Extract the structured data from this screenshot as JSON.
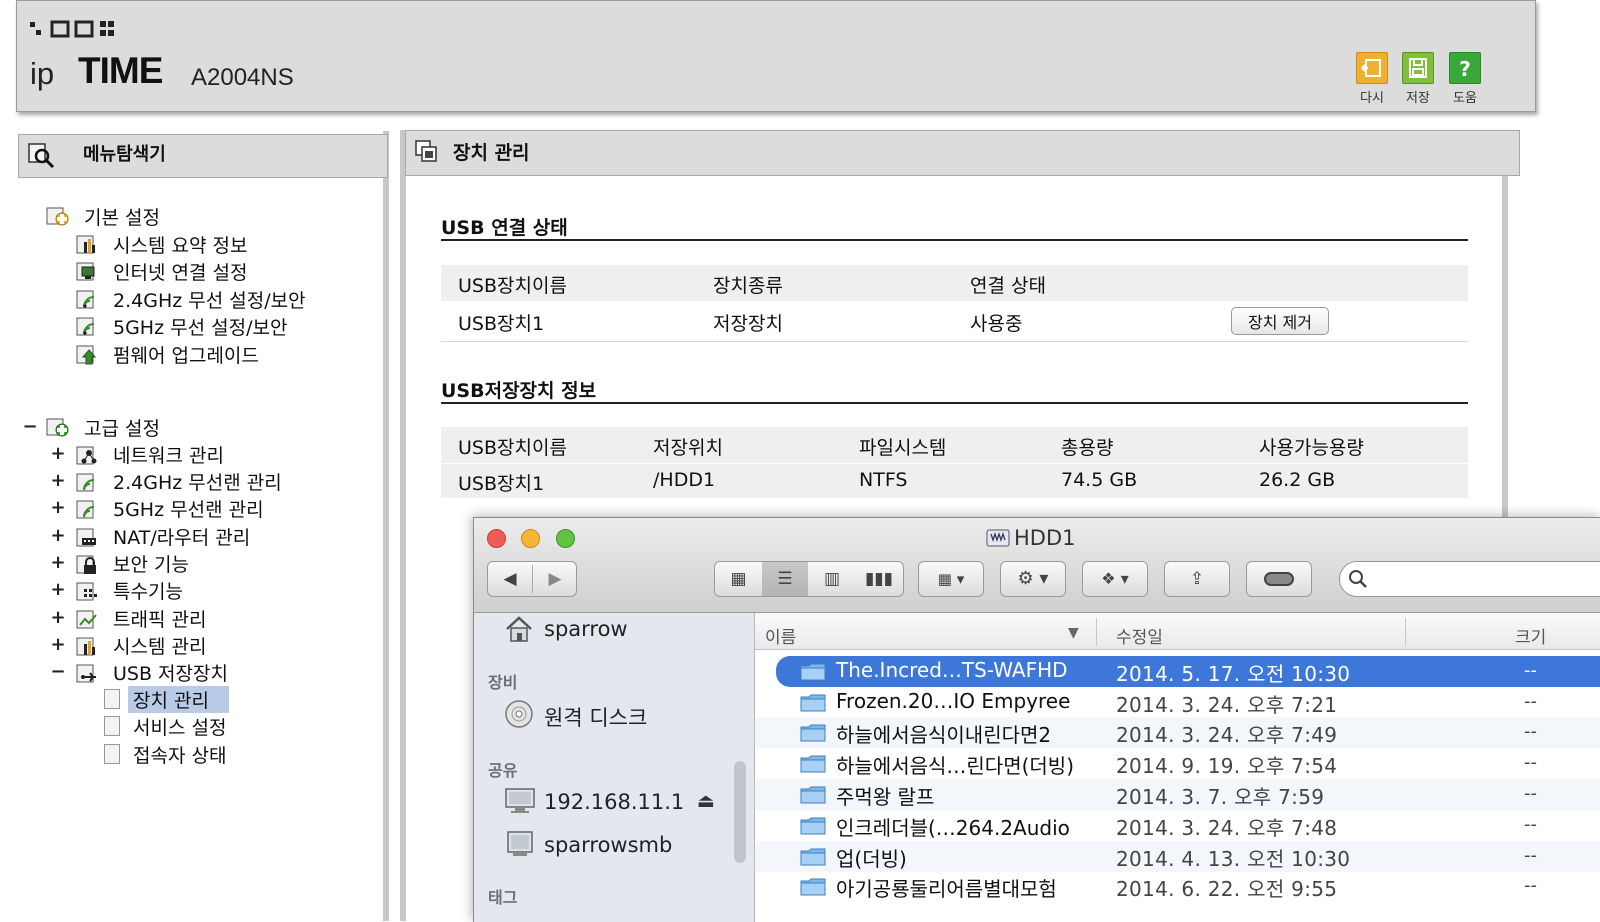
{
  "router": {
    "brand_ip": "ip",
    "brand_time": "TIME",
    "model": "A2004NS",
    "header_buttons": [
      {
        "label": "다시",
        "icon": "refresh-icon",
        "color": "#f0b030"
      },
      {
        "label": "저장",
        "icon": "save-icon",
        "color": "#7fbf3a"
      },
      {
        "label": "도움",
        "icon": "help-icon",
        "color": "#3aa838"
      }
    ]
  },
  "menu": {
    "title": "메뉴탐색기",
    "basic": {
      "label": "기본 설정",
      "items": [
        "시스템 요약 정보",
        "인터넷 연결 설정",
        "2.4GHz 무선 설정/보안",
        "5GHz 무선 설정/보안",
        "펌웨어 업그레이드"
      ]
    },
    "advanced": {
      "expander": "−",
      "label": "고급 설정",
      "items": [
        {
          "exp": "+",
          "label": "네트워크 관리"
        },
        {
          "exp": "+",
          "label": "2.4GHz 무선랜 관리"
        },
        {
          "exp": "+",
          "label": "5GHz 무선랜 관리"
        },
        {
          "exp": "+",
          "label": "NAT/라우터 관리"
        },
        {
          "exp": "+",
          "label": "보안 기능"
        },
        {
          "exp": "+",
          "label": "특수기능"
        },
        {
          "exp": "+",
          "label": "트래픽 관리"
        },
        {
          "exp": "+",
          "label": "시스템 관리"
        },
        {
          "exp": "−",
          "label": "USB 저장장치"
        }
      ],
      "usb_children": [
        "장치 관리",
        "서비스 설정",
        "접속자 상태"
      ]
    }
  },
  "content": {
    "title": "장치 관리",
    "usb_status": {
      "heading": "USB 연결 상태",
      "headers": [
        "USB장치이름",
        "장치종류",
        "연결 상태"
      ],
      "row": [
        "USB장치1",
        "저장장치",
        "사용중"
      ],
      "remove_button": "장치 제거"
    },
    "usb_storage": {
      "heading": "USB저장장치 정보",
      "headers": [
        "USB장치이름",
        "저장위치",
        "파일시스템",
        "총용량",
        "사용가능용량"
      ],
      "row": [
        "USB장치1",
        "/HDD1",
        "NTFS",
        "74.5 GB",
        "26.2 GB"
      ]
    }
  },
  "finder": {
    "title": "HDD1",
    "sidebar": {
      "user": "sparrow",
      "devices_header": "장비",
      "remote_disc": "원격 디스크",
      "shared_header": "공유",
      "shared": [
        "192.168.11.1",
        "sparrowsmb"
      ],
      "eject": "⏏",
      "tags_header": "태그"
    },
    "columns": {
      "name": "이름",
      "sort_arrow": "▼",
      "modified": "수정일",
      "size": "크기"
    },
    "files": [
      {
        "name": "The.Incred…TS-WAFHD",
        "date": "2014. 5. 17. 오전 10:30",
        "size": "--"
      },
      {
        "name": "Frozen.20…IO Empyree",
        "date": "2014. 3. 24. 오후 7:21",
        "size": "--"
      },
      {
        "name": "하늘에서음식이내린다면2",
        "date": "2014. 3. 24. 오후 7:49",
        "size": "--"
      },
      {
        "name": "하늘에서음식…린다면(더빙)",
        "date": "2014. 9. 19. 오후 7:54",
        "size": "--"
      },
      {
        "name": "주먹왕 랄프",
        "date": "2014. 3. 7. 오후 7:59",
        "size": "--"
      },
      {
        "name": "인크레더블(…264.2Audio",
        "date": "2014. 3. 24. 오후 7:48",
        "size": "--"
      },
      {
        "name": "업(더빙)",
        "date": "2014. 4. 13. 오전 10:30",
        "size": "--"
      },
      {
        "name": "아기공룡둘리어름별대모험",
        "date": "2014. 6. 22. 오전 9:55",
        "size": "--"
      }
    ],
    "selected_color": "#3d77d9"
  }
}
